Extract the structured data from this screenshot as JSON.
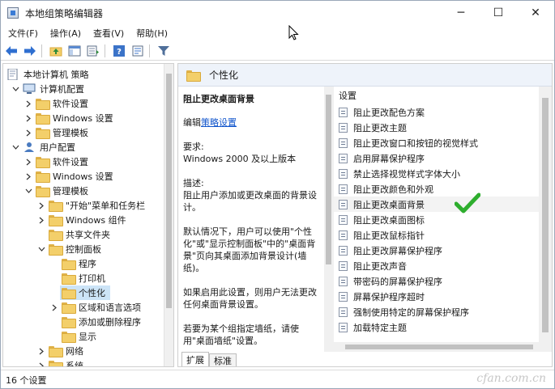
{
  "window": {
    "title": "本地组策略编辑器",
    "controls": {
      "minimize": "─",
      "maximize": "☐",
      "close": "✕"
    }
  },
  "menu": [
    "文件(F)",
    "操作(A)",
    "查看(V)",
    "帮助(H)"
  ],
  "toolbar": [
    "back-icon",
    "forward-icon",
    "up-folder-icon",
    "show-hide-tree-icon",
    "export-list-icon",
    "help-icon",
    "properties-icon",
    "filter-icon"
  ],
  "tree": {
    "root": "本地计算机 策略",
    "items": [
      {
        "label": "计算机配置",
        "icon": "pc"
      },
      {
        "label": "软件设置"
      },
      {
        "label": "Windows 设置"
      },
      {
        "label": "管理模板"
      },
      {
        "label": "用户配置",
        "icon": "user"
      },
      {
        "label": "软件设置"
      },
      {
        "label": "Windows 设置"
      },
      {
        "label": "管理模板"
      },
      {
        "label": "\"开始\"菜单和任务栏"
      },
      {
        "label": "Windows 组件"
      },
      {
        "label": "共享文件夹"
      },
      {
        "label": "控制面板"
      },
      {
        "label": "程序"
      },
      {
        "label": "打印机"
      },
      {
        "label": "个性化"
      },
      {
        "label": "区域和语言选项"
      },
      {
        "label": "添加或删除程序"
      },
      {
        "label": "显示"
      },
      {
        "label": "网络"
      },
      {
        "label": "系统"
      }
    ]
  },
  "right": {
    "header_title": "个性化",
    "desc": {
      "title": "阻止更改桌面背景",
      "edit_prefix": "编辑",
      "edit_link": "策略设置",
      "req_label": "要求:",
      "req_value": "Windows 2000 及以上版本",
      "desc_label": "描述:",
      "desc_text": "阻止用户添加或更改桌面的背景设计。",
      "para1": "默认情况下，用户可以使用\"个性化\"或\"显示控制面板\"中的\"桌面背景\"页向其桌面添加背景设计(墙纸)。",
      "para2": "如果启用此设置，则用户无法更改任何桌面背景设置。",
      "para3": "若要为某个组指定墙纸，请使用\"桌面墙纸\"设置。"
    },
    "settings_header": "设置",
    "settings": [
      "阻止更改配色方案",
      "阻止更改主题",
      "阻止更改窗口和按钮的视觉样式",
      "启用屏幕保护程序",
      "禁止选择视觉样式字体大小",
      "阻止更改颜色和外观",
      "阻止更改桌面背景",
      "阻止更改桌面图标",
      "阻止更改鼠标指针",
      "阻止更改屏幕保护程序",
      "阻止更改声音",
      "带密码的屏幕保护程序",
      "屏幕保护程序超时",
      "强制使用特定的屏幕保护程序",
      "加载特定主题"
    ],
    "tabs": [
      "扩展",
      "标准"
    ]
  },
  "status": "16 个设置",
  "watermark": "cfan.com.cn",
  "colors": {
    "selection": "#cce4f7",
    "header_bg": "#eef3fa",
    "link": "#1155cc",
    "check": "#2eae2e"
  }
}
